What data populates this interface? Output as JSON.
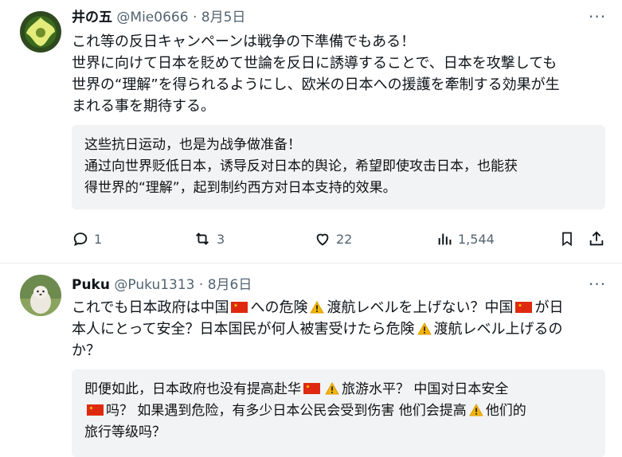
{
  "post1": {
    "display_name": "井の五",
    "handle": "@Mie0666",
    "date": "8月5日",
    "lines": [
      "これ等の反日キャンペーンは戦争の下準備でもある！",
      "世界に向けて日本を貶めて世論を反日に誘導することで、日本を攻撃しても",
      "世界の“理解”を得られるようにし、欧米の日本への援護を牽制する効果が生",
      "まれる事を期待する。"
    ],
    "translation": [
      "这些抗日运动，也是为战争做准备！",
      "通过向世界贬低日本，诱导反对日本的舆论，希望即使攻击日本，也能获",
      "得世界的“理解”，起到制约西方对日本支持的效果。"
    ],
    "reply_count": "1",
    "repost_count": "3",
    "like_count": "22",
    "view_count": "1,544"
  },
  "post2": {
    "display_name": "Puku",
    "handle": "@Puku1313",
    "date": "8月6日",
    "line1_a": "これでも日本政府は中国",
    "line1_b": "への危険",
    "line1_c": "渡航レベルを上げない？中国",
    "line1_d": "が日",
    "line2_a": "本人にとって安全？日本国民が何人被害受けたら危険",
    "line2_b": "渡航レベル上げるの",
    "line3": "か？",
    "tr1_a": "即便如此，日本政府也没有提高赴华",
    "tr1_b": "旅游水平？ 中国对日本安全",
    "tr2_a": "吗？ 如果遇到危险，有多少日本公民会受到伤害 他们会提高",
    "tr2_b": "他们的",
    "tr3": "旅行等级吗？"
  },
  "icons": {
    "more": "more-options-icon",
    "reply": "reply-icon",
    "repost": "repost-icon",
    "like": "like-icon",
    "views": "views-icon",
    "bookmark": "bookmark-icon",
    "share": "share-icon",
    "flag": "china-flag-icon",
    "warning": "warning-icon"
  },
  "colors": {
    "text": "#0f1419",
    "muted": "#536471",
    "translation_bg": "#f2f3f5",
    "divider": "#e6e8ea"
  }
}
